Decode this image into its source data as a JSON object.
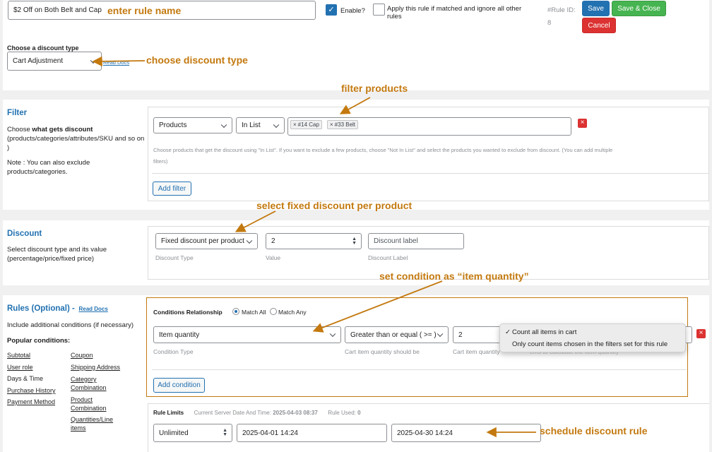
{
  "header": {
    "rule_name_value": "$2 Off on Both Belt and Cap",
    "enable_label": "Enable?",
    "apply_only_label_line1": "Apply this rule if matched and ignore all other",
    "apply_only_label_line2": "rules",
    "rule_id_label": "#Rule ID:",
    "rule_id_value": "8",
    "save_label": "Save",
    "save_close_label": "Save & Close",
    "cancel_label": "Cancel"
  },
  "discount_type": {
    "label": "Choose a discount type",
    "value": "Cart Adjustment",
    "docs_link": "Read Docs"
  },
  "filter": {
    "title": "Filter",
    "desc_prefix": "Choose ",
    "desc_bold": "what gets discount",
    "desc_rest": "(products/categories/attributes/SKU and so on )",
    "note": "Note : You can also exclude products/categories.",
    "type_value": "Products",
    "method_value": "In List",
    "tags": [
      "#14 Cap",
      "#33 Belt"
    ],
    "help_line1": "Choose products that get the discount using \"In List\". If you want to exclude a few products, choose \"Not In List\" and select the products you wanted to exclude from discount. (You can add multiple",
    "help_line2": "filters)",
    "add_filter_label": "Add filter"
  },
  "discount": {
    "title": "Discount",
    "desc": "Select discount type and its value (percentage/price/fixed price)",
    "type_value": "Fixed discount per product",
    "type_caption": "Discount Type",
    "value": "2",
    "value_caption": "Value",
    "label_placeholder": "Discount label",
    "label_caption": "Discount Label"
  },
  "rules": {
    "title": "Rules (Optional) -",
    "docs_link": "Read Docs",
    "desc": "Include additional conditions (if necessary)",
    "popular_label": "Popular conditions:",
    "left_links": [
      "Subtotal",
      "User role",
      "Days & Time",
      "Purchase History",
      "Payment Method"
    ],
    "right_links": [
      "Coupon",
      "Shipping Address",
      "Category Combination",
      "Product Combination",
      "Quantities/Line items"
    ],
    "relationship_label": "Conditions Relationship",
    "match_all": "Match All",
    "match_any": "Match Any",
    "condition_type_value": "Item quantity",
    "condition_type_caption": "Condition Type",
    "operator_value": "Greater than or equal ( >= )",
    "operator_caption": "Cart item quantity should be",
    "qty_value": "2",
    "qty_caption": "Cart item quantity",
    "hidden_caption_tail": "ems to calculate the item quantity",
    "dropdown_options": [
      "Count all items in cart",
      "Only count items chosen in the filters set for this rule"
    ],
    "dropdown_checkmark": "✓",
    "add_condition_label": "Add condition"
  },
  "limits": {
    "title": "Rule Limits",
    "server_time_label": "Current Server Date And Time:",
    "server_time_value": "2025-04-03 08:37",
    "rule_used_label": "Rule Used:",
    "rule_used_value": "0",
    "usage_value": "Unlimited",
    "start_value": "2025-04-01 14:24",
    "end_value": "2025-04-30 14:24"
  },
  "annotations": {
    "enter_rule_name": "enter rule name",
    "choose_discount_type": "choose discount type",
    "filter_products": "filter products",
    "select_fixed": "select fixed discount per product",
    "set_condition": "set condition as “item quantity”",
    "schedule": "schedule discount rule"
  },
  "colors": {
    "annotation": "#c3790f",
    "accent": "#2271b1",
    "save_green": "#46b450",
    "cancel_red": "#dc3232"
  }
}
